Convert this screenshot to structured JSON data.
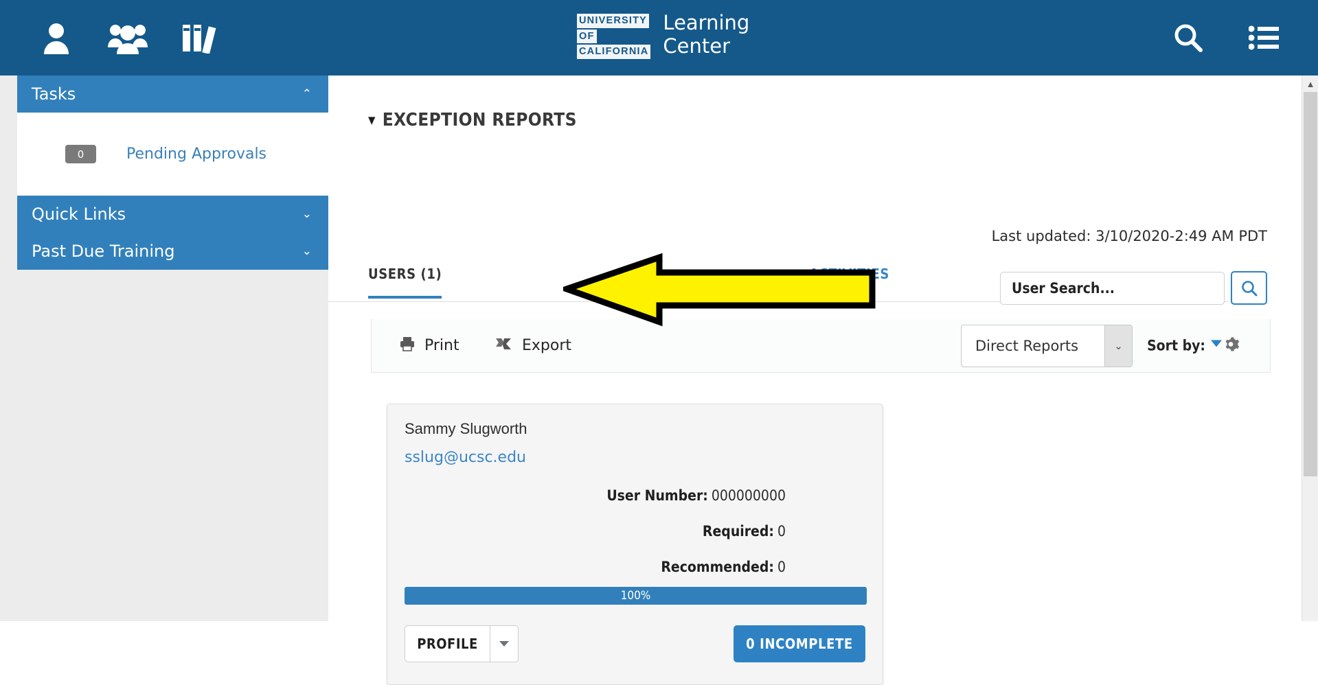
{
  "topbar": {
    "bg_color": "#14598a",
    "left_icons": [
      {
        "name": "person-icon",
        "label": "My Account"
      },
      {
        "name": "people-icon",
        "label": "My Team"
      },
      {
        "name": "books-icon",
        "label": "Library"
      }
    ],
    "logo": {
      "line1": "UNIVERSITY",
      "line2": "OF",
      "line3": "CALIFORNIA"
    },
    "title": "Learning\nCenter",
    "right_icons": [
      {
        "name": "search-icon",
        "label": "Search"
      },
      {
        "name": "menu-list-icon",
        "label": "Menu"
      }
    ]
  },
  "sidebar": {
    "sections": [
      {
        "title": "Tasks",
        "chevron": "⌃",
        "expanded": true,
        "items": [
          {
            "badge": "0",
            "label": "Pending Approvals"
          }
        ]
      },
      {
        "title": "Quick Links",
        "chevron": "⌄",
        "expanded": false,
        "items": []
      },
      {
        "title": "Past Due Training",
        "chevron": "⌄",
        "expanded": false,
        "items": []
      }
    ]
  },
  "main": {
    "section_heading": "EXCEPTION REPORTS",
    "section_caret": "▼",
    "last_updated": "Last updated: 3/10/2020-2:49 AM PDT",
    "tabs": [
      {
        "label": "USERS (1)",
        "active": true
      },
      {
        "label": "ACTIVITIES",
        "active": false
      }
    ],
    "search": {
      "placeholder": "User Search...",
      "value": "",
      "button_icon": "search-icon"
    },
    "toolbar": {
      "print_label": "Print",
      "print_icon": "printer-icon",
      "export_label": "Export",
      "export_icon": "excel-export-icon",
      "select_value": "Direct Reports",
      "select_chevron": "⌄",
      "sort_label": "Sort by:",
      "sort_icon": "gear-icon"
    },
    "user_card": {
      "name": "Sammy Slugworth",
      "email": "sslug@ucsc.edu",
      "fields": [
        {
          "key": "User Number:",
          "value": "000000000"
        },
        {
          "key": "Required:",
          "value": "0"
        },
        {
          "key": "Recommended:",
          "value": "0"
        }
      ],
      "progress_label": "100%",
      "progress_percent": 100,
      "profile_button": "PROFILE",
      "incomplete_button": "0 INCOMPLETE"
    }
  },
  "annotation": {
    "type": "arrow",
    "direction": "left",
    "fill_color": "#FFF200",
    "stroke_color": "#000000",
    "points_at": "ACTIVITIES"
  },
  "colors": {
    "brand_dark_blue": "#14598a",
    "accent_blue": "#3280bb",
    "link_blue": "#3a86c8",
    "badge_gray": "#7a7a7a"
  }
}
